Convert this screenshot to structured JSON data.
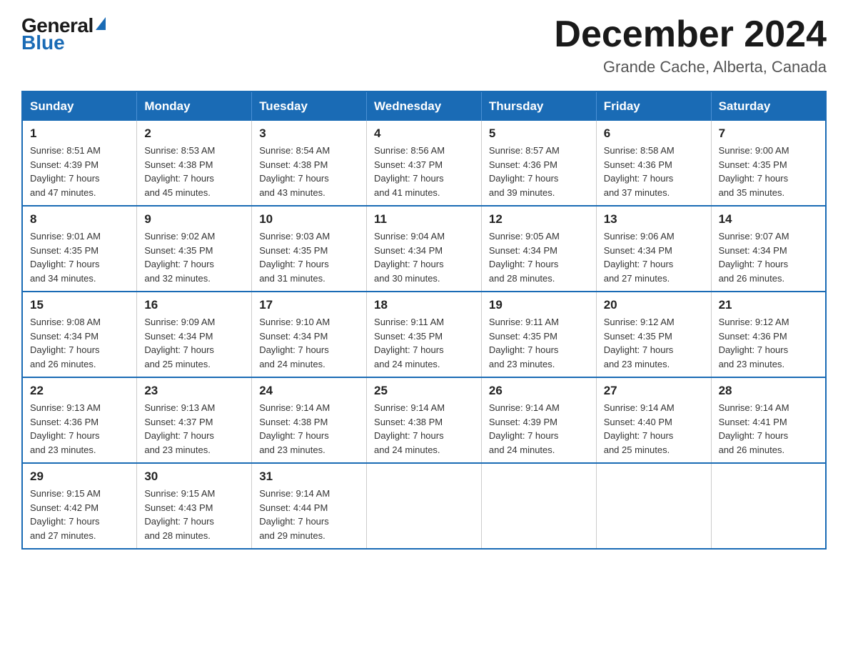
{
  "header": {
    "logo_general": "General",
    "logo_blue": "Blue",
    "month_title": "December 2024",
    "location": "Grande Cache, Alberta, Canada"
  },
  "days_of_week": [
    "Sunday",
    "Monday",
    "Tuesday",
    "Wednesday",
    "Thursday",
    "Friday",
    "Saturday"
  ],
  "weeks": [
    [
      {
        "day": "1",
        "sunrise": "8:51 AM",
        "sunset": "4:39 PM",
        "daylight": "7 hours and 47 minutes."
      },
      {
        "day": "2",
        "sunrise": "8:53 AM",
        "sunset": "4:38 PM",
        "daylight": "7 hours and 45 minutes."
      },
      {
        "day": "3",
        "sunrise": "8:54 AM",
        "sunset": "4:38 PM",
        "daylight": "7 hours and 43 minutes."
      },
      {
        "day": "4",
        "sunrise": "8:56 AM",
        "sunset": "4:37 PM",
        "daylight": "7 hours and 41 minutes."
      },
      {
        "day": "5",
        "sunrise": "8:57 AM",
        "sunset": "4:36 PM",
        "daylight": "7 hours and 39 minutes."
      },
      {
        "day": "6",
        "sunrise": "8:58 AM",
        "sunset": "4:36 PM",
        "daylight": "7 hours and 37 minutes."
      },
      {
        "day": "7",
        "sunrise": "9:00 AM",
        "sunset": "4:35 PM",
        "daylight": "7 hours and 35 minutes."
      }
    ],
    [
      {
        "day": "8",
        "sunrise": "9:01 AM",
        "sunset": "4:35 PM",
        "daylight": "7 hours and 34 minutes."
      },
      {
        "day": "9",
        "sunrise": "9:02 AM",
        "sunset": "4:35 PM",
        "daylight": "7 hours and 32 minutes."
      },
      {
        "day": "10",
        "sunrise": "9:03 AM",
        "sunset": "4:35 PM",
        "daylight": "7 hours and 31 minutes."
      },
      {
        "day": "11",
        "sunrise": "9:04 AM",
        "sunset": "4:34 PM",
        "daylight": "7 hours and 30 minutes."
      },
      {
        "day": "12",
        "sunrise": "9:05 AM",
        "sunset": "4:34 PM",
        "daylight": "7 hours and 28 minutes."
      },
      {
        "day": "13",
        "sunrise": "9:06 AM",
        "sunset": "4:34 PM",
        "daylight": "7 hours and 27 minutes."
      },
      {
        "day": "14",
        "sunrise": "9:07 AM",
        "sunset": "4:34 PM",
        "daylight": "7 hours and 26 minutes."
      }
    ],
    [
      {
        "day": "15",
        "sunrise": "9:08 AM",
        "sunset": "4:34 PM",
        "daylight": "7 hours and 26 minutes."
      },
      {
        "day": "16",
        "sunrise": "9:09 AM",
        "sunset": "4:34 PM",
        "daylight": "7 hours and 25 minutes."
      },
      {
        "day": "17",
        "sunrise": "9:10 AM",
        "sunset": "4:34 PM",
        "daylight": "7 hours and 24 minutes."
      },
      {
        "day": "18",
        "sunrise": "9:11 AM",
        "sunset": "4:35 PM",
        "daylight": "7 hours and 24 minutes."
      },
      {
        "day": "19",
        "sunrise": "9:11 AM",
        "sunset": "4:35 PM",
        "daylight": "7 hours and 23 minutes."
      },
      {
        "day": "20",
        "sunrise": "9:12 AM",
        "sunset": "4:35 PM",
        "daylight": "7 hours and 23 minutes."
      },
      {
        "day": "21",
        "sunrise": "9:12 AM",
        "sunset": "4:36 PM",
        "daylight": "7 hours and 23 minutes."
      }
    ],
    [
      {
        "day": "22",
        "sunrise": "9:13 AM",
        "sunset": "4:36 PM",
        "daylight": "7 hours and 23 minutes."
      },
      {
        "day": "23",
        "sunrise": "9:13 AM",
        "sunset": "4:37 PM",
        "daylight": "7 hours and 23 minutes."
      },
      {
        "day": "24",
        "sunrise": "9:14 AM",
        "sunset": "4:38 PM",
        "daylight": "7 hours and 23 minutes."
      },
      {
        "day": "25",
        "sunrise": "9:14 AM",
        "sunset": "4:38 PM",
        "daylight": "7 hours and 24 minutes."
      },
      {
        "day": "26",
        "sunrise": "9:14 AM",
        "sunset": "4:39 PM",
        "daylight": "7 hours and 24 minutes."
      },
      {
        "day": "27",
        "sunrise": "9:14 AM",
        "sunset": "4:40 PM",
        "daylight": "7 hours and 25 minutes."
      },
      {
        "day": "28",
        "sunrise": "9:14 AM",
        "sunset": "4:41 PM",
        "daylight": "7 hours and 26 minutes."
      }
    ],
    [
      {
        "day": "29",
        "sunrise": "9:15 AM",
        "sunset": "4:42 PM",
        "daylight": "7 hours and 27 minutes."
      },
      {
        "day": "30",
        "sunrise": "9:15 AM",
        "sunset": "4:43 PM",
        "daylight": "7 hours and 28 minutes."
      },
      {
        "day": "31",
        "sunrise": "9:14 AM",
        "sunset": "4:44 PM",
        "daylight": "7 hours and 29 minutes."
      },
      null,
      null,
      null,
      null
    ]
  ],
  "labels": {
    "sunrise": "Sunrise:",
    "sunset": "Sunset:",
    "daylight": "Daylight:"
  }
}
